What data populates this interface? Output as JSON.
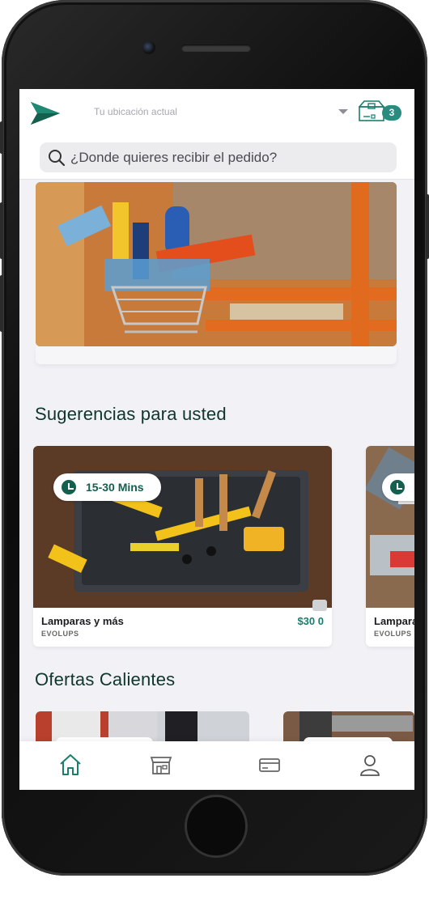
{
  "header": {
    "location_label": "Tu ubicación actual",
    "cart_count": "3",
    "search_placeholder": "¿Donde quieres recibir el pedido?"
  },
  "sections": {
    "suggestions_title": "Sugerencias para usted",
    "offers_title": "Ofertas Calientes"
  },
  "products": [
    {
      "delivery_time": "15-30 Mins",
      "name": "Lamparas y más",
      "store": "EVOLUPS",
      "price": "$30 0"
    },
    {
      "delivery_time": "",
      "name": "Lampara",
      "store": "EVOLUPS",
      "price": ""
    }
  ],
  "bottom_nav": [
    {
      "icon": "home-icon",
      "active": true
    },
    {
      "icon": "store-icon",
      "active": false
    },
    {
      "icon": "credit-card-icon",
      "active": false
    },
    {
      "icon": "user-icon",
      "active": false
    }
  ],
  "colors": {
    "brand_green": "#14604f",
    "accent_teal": "#2a8b7e",
    "price_green": "#1a7e6e",
    "screen_bg": "#f1f1f6"
  }
}
